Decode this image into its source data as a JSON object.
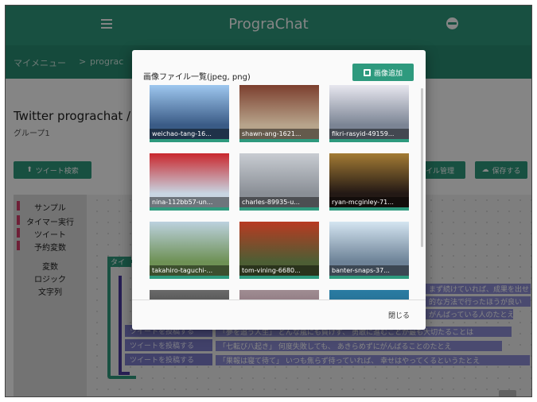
{
  "app": {
    "title": "PrograChat"
  },
  "header": {
    "menu_icon": "hamburger-icon",
    "globe_icon": "globe-icon"
  },
  "breadcrumb": {
    "items": [
      "マイメニュー",
      "prograc"
    ],
    "separator": ">"
  },
  "page": {
    "title": "Twitter prograchat / ク",
    "subtitle": "グループ1",
    "tweet_search_label": "ツイート検索",
    "file_manage_label": "イル管理",
    "save_label": "保存する"
  },
  "toolbox": {
    "items": [
      {
        "label": "サンプル",
        "marked": true
      },
      {
        "label": "タイマー実行",
        "marked": true
      },
      {
        "label": "ツイート",
        "marked": true
      },
      {
        "label": "予約変数",
        "marked": true
      },
      {
        "label": "変数",
        "marked": false
      },
      {
        "label": "ロジック",
        "marked": false
      },
      {
        "label": "文字列",
        "marked": false
      }
    ]
  },
  "workspace": {
    "block_label": "タイ",
    "tweet_block_label": "ツイートを投稿する",
    "strings": [
      "まず続けていれば、成果を出せ",
      "的な方法で行ったほうが良い",
      "がんばっている人のたとえ",
      "「夢を追う人生」 どんな嵐にも負けず、 勇敢に進むことが最も大切たることは",
      "「七転び八起き」 何度失敗しても、 あきらめずにがんばることのたとえ",
      "「果報は寝て待て」 いつも焦らず待っていれば、 幸せはやってくるというたとえ"
    ]
  },
  "dialog": {
    "title": "画像ファイル一覧(jpeg, png)",
    "add_button_label": "画像追加",
    "close_label": "閉じる",
    "images": [
      {
        "caption": "weichao-tang-16...",
        "bg": "#3a5b86",
        "accent": "#9ec7ef"
      },
      {
        "caption": "shawn-ang-1621...",
        "bg": "#b7a48b",
        "accent": "#7c3f2e"
      },
      {
        "caption": "fikri-rasyid-49159...",
        "bg": "#7b8494",
        "accent": "#e7e7ef"
      },
      {
        "caption": "nina-112bb57-un...",
        "bg": "#c8d5e2",
        "accent": "#c9272d"
      },
      {
        "caption": "charles-89935-u...",
        "bg": "#8a8f96",
        "accent": "#c8ccd2"
      },
      {
        "caption": "ryan-mcginley-71...",
        "bg": "#231915",
        "accent": "#a37b34"
      },
      {
        "caption": "takahiro-taguchi-...",
        "bg": "#6e9155",
        "accent": "#bcd1de"
      },
      {
        "caption": "tom-vining-6680...",
        "bg": "#4d5e34",
        "accent": "#b83a22"
      },
      {
        "caption": "banter-snaps-37...",
        "bg": "#6d8297",
        "accent": "#d4e5f1"
      },
      {
        "caption": "",
        "bg": "#2b2b2b",
        "accent": "#6a6a6a"
      },
      {
        "caption": "",
        "bg": "#6f5560",
        "accent": "#a08d93"
      },
      {
        "caption": "",
        "bg": "#1e5a7a",
        "accent": "#2a7ca3"
      }
    ]
  },
  "colors": {
    "primary": "#2e9a7e",
    "primary_dark": "#2a8f74",
    "scrim": "rgba(0,0,0,0.48)"
  }
}
